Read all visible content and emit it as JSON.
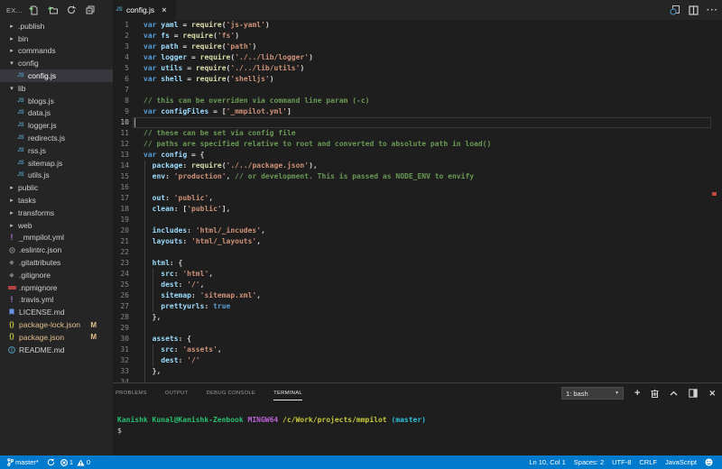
{
  "explorer": {
    "title": "EX...",
    "actions": [
      {
        "name": "new-file"
      },
      {
        "name": "new-folder"
      },
      {
        "name": "refresh"
      },
      {
        "name": "collapse-all"
      }
    ],
    "items": [
      {
        "label": ".publish",
        "kind": "folder",
        "depth": 0,
        "expanded": false
      },
      {
        "label": "bin",
        "kind": "folder",
        "depth": 0,
        "expanded": false
      },
      {
        "label": "commands",
        "kind": "folder",
        "depth": 0,
        "expanded": false
      },
      {
        "label": "config",
        "kind": "folder",
        "depth": 0,
        "expanded": true
      },
      {
        "label": "config.js",
        "kind": "file",
        "depth": 1,
        "icon": "js",
        "selected": true
      },
      {
        "label": "lib",
        "kind": "folder",
        "depth": 0,
        "expanded": true
      },
      {
        "label": "blogs.js",
        "kind": "file",
        "depth": 1,
        "icon": "js"
      },
      {
        "label": "data.js",
        "kind": "file",
        "depth": 1,
        "icon": "js"
      },
      {
        "label": "logger.js",
        "kind": "file",
        "depth": 1,
        "icon": "js"
      },
      {
        "label": "redirects.js",
        "kind": "file",
        "depth": 1,
        "icon": "js"
      },
      {
        "label": "rss.js",
        "kind": "file",
        "depth": 1,
        "icon": "js"
      },
      {
        "label": "sitemap.js",
        "kind": "file",
        "depth": 1,
        "icon": "js"
      },
      {
        "label": "utils.js",
        "kind": "file",
        "depth": 1,
        "icon": "js"
      },
      {
        "label": "public",
        "kind": "folder",
        "depth": 0,
        "expanded": false
      },
      {
        "label": "tasks",
        "kind": "folder",
        "depth": 0,
        "expanded": false
      },
      {
        "label": "transforms",
        "kind": "folder",
        "depth": 0,
        "expanded": false
      },
      {
        "label": "web",
        "kind": "folder",
        "depth": 0,
        "expanded": false
      },
      {
        "label": "_mmpilot.yml",
        "kind": "file",
        "depth": 0,
        "icon": "yml"
      },
      {
        "label": ".eslintrc.json",
        "kind": "file",
        "depth": 0,
        "icon": "eslint"
      },
      {
        "label": ".gitattributes",
        "kind": "file",
        "depth": 0,
        "icon": "git"
      },
      {
        "label": ".gitignore",
        "kind": "file",
        "depth": 0,
        "icon": "git"
      },
      {
        "label": ".npmignore",
        "kind": "file",
        "depth": 0,
        "icon": "npm"
      },
      {
        "label": ".travis.yml",
        "kind": "file",
        "depth": 0,
        "icon": "yml"
      },
      {
        "label": "LICENSE.md",
        "kind": "file",
        "depth": 0,
        "icon": "license"
      },
      {
        "label": "package-lock.json",
        "kind": "file",
        "depth": 0,
        "icon": "json",
        "modified": true,
        "badge": "M"
      },
      {
        "label": "package.json",
        "kind": "file",
        "depth": 0,
        "icon": "json",
        "modified": true,
        "badge": "M"
      },
      {
        "label": "README.md",
        "kind": "file",
        "depth": 0,
        "icon": "info"
      }
    ]
  },
  "editor": {
    "tab": {
      "icon": "js",
      "label": "config.js",
      "close": "×"
    },
    "actions": [
      {
        "name": "open-changes"
      },
      {
        "name": "split-editor"
      },
      {
        "name": "more-actions"
      }
    ],
    "cursor_line": 10,
    "lines": [
      {
        "n": 1,
        "tokens": [
          [
            "kw",
            "var"
          ],
          [
            "pl",
            " "
          ],
          [
            "id",
            "yaml"
          ],
          [
            "pl",
            " = "
          ],
          [
            "fn",
            "require"
          ],
          [
            "pl",
            "("
          ],
          [
            "str",
            "'js-yaml'"
          ],
          [
            "pl",
            ")"
          ]
        ]
      },
      {
        "n": 2,
        "tokens": [
          [
            "kw",
            "var"
          ],
          [
            "pl",
            " "
          ],
          [
            "id",
            "fs"
          ],
          [
            "pl",
            " = "
          ],
          [
            "fn",
            "require"
          ],
          [
            "pl",
            "("
          ],
          [
            "str",
            "'fs'"
          ],
          [
            "pl",
            ")"
          ]
        ]
      },
      {
        "n": 3,
        "tokens": [
          [
            "kw",
            "var"
          ],
          [
            "pl",
            " "
          ],
          [
            "id",
            "path"
          ],
          [
            "pl",
            " = "
          ],
          [
            "fn",
            "require"
          ],
          [
            "pl",
            "("
          ],
          [
            "str",
            "'path'"
          ],
          [
            "pl",
            ")"
          ]
        ]
      },
      {
        "n": 4,
        "tokens": [
          [
            "kw",
            "var"
          ],
          [
            "pl",
            " "
          ],
          [
            "id",
            "logger"
          ],
          [
            "pl",
            " = "
          ],
          [
            "fn",
            "require"
          ],
          [
            "pl",
            "("
          ],
          [
            "str",
            "'./../lib/logger'"
          ],
          [
            "pl",
            ")"
          ]
        ]
      },
      {
        "n": 5,
        "tokens": [
          [
            "kw",
            "var"
          ],
          [
            "pl",
            " "
          ],
          [
            "id",
            "utils"
          ],
          [
            "pl",
            " = "
          ],
          [
            "fn",
            "require"
          ],
          [
            "pl",
            "("
          ],
          [
            "str",
            "'./../lib/utils'"
          ],
          [
            "pl",
            ")"
          ]
        ]
      },
      {
        "n": 6,
        "tokens": [
          [
            "kw",
            "var"
          ],
          [
            "pl",
            " "
          ],
          [
            "id",
            "shell"
          ],
          [
            "pl",
            " = "
          ],
          [
            "fn",
            "require"
          ],
          [
            "pl",
            "("
          ],
          [
            "str",
            "'shelljs'"
          ],
          [
            "pl",
            ")"
          ]
        ]
      },
      {
        "n": 7,
        "tokens": []
      },
      {
        "n": 8,
        "tokens": [
          [
            "cm",
            "// this can be overriden via command line param (-c)"
          ]
        ]
      },
      {
        "n": 9,
        "tokens": [
          [
            "kw",
            "var"
          ],
          [
            "pl",
            " "
          ],
          [
            "id",
            "configFiles"
          ],
          [
            "pl",
            " = ["
          ],
          [
            "str",
            "'_mmpilot.yml'"
          ],
          [
            "pl",
            "]"
          ]
        ]
      },
      {
        "n": 10,
        "tokens": []
      },
      {
        "n": 11,
        "tokens": [
          [
            "cm",
            "// these can be set via config file"
          ]
        ]
      },
      {
        "n": 12,
        "tokens": [
          [
            "cm",
            "// paths are specified relative to root and converted to absolute path in load()"
          ]
        ]
      },
      {
        "n": 13,
        "tokens": [
          [
            "kw",
            "var"
          ],
          [
            "pl",
            " "
          ],
          [
            "id",
            "config"
          ],
          [
            "pl",
            " = {"
          ]
        ]
      },
      {
        "n": 14,
        "tokens": [
          [
            "pl",
            "  "
          ],
          [
            "id",
            "package"
          ],
          [
            "pl",
            ": "
          ],
          [
            "fn",
            "require"
          ],
          [
            "pl",
            "("
          ],
          [
            "str",
            "'./../package.json'"
          ],
          [
            "pl",
            "),"
          ]
        ]
      },
      {
        "n": 15,
        "tokens": [
          [
            "pl",
            "  "
          ],
          [
            "id",
            "env"
          ],
          [
            "pl",
            ": "
          ],
          [
            "str",
            "'production'"
          ],
          [
            "pl",
            ", "
          ],
          [
            "cm",
            "// or development. This is passed as NODE_ENV to envify"
          ]
        ]
      },
      {
        "n": 16,
        "tokens": []
      },
      {
        "n": 17,
        "tokens": [
          [
            "pl",
            "  "
          ],
          [
            "id",
            "out"
          ],
          [
            "pl",
            ": "
          ],
          [
            "str",
            "'public'"
          ],
          [
            "pl",
            ","
          ]
        ]
      },
      {
        "n": 18,
        "tokens": [
          [
            "pl",
            "  "
          ],
          [
            "id",
            "clean"
          ],
          [
            "pl",
            ": ["
          ],
          [
            "str",
            "'public'"
          ],
          [
            "pl",
            "],"
          ]
        ]
      },
      {
        "n": 19,
        "tokens": []
      },
      {
        "n": 20,
        "tokens": [
          [
            "pl",
            "  "
          ],
          [
            "id",
            "includes"
          ],
          [
            "pl",
            ": "
          ],
          [
            "str",
            "'html/_incudes'"
          ],
          [
            "pl",
            ","
          ]
        ]
      },
      {
        "n": 21,
        "tokens": [
          [
            "pl",
            "  "
          ],
          [
            "id",
            "layouts"
          ],
          [
            "pl",
            ": "
          ],
          [
            "str",
            "'html/_layouts'"
          ],
          [
            "pl",
            ","
          ]
        ]
      },
      {
        "n": 22,
        "tokens": []
      },
      {
        "n": 23,
        "tokens": [
          [
            "pl",
            "  "
          ],
          [
            "id",
            "html"
          ],
          [
            "pl",
            ": {"
          ]
        ]
      },
      {
        "n": 24,
        "tokens": [
          [
            "pl",
            "    "
          ],
          [
            "id",
            "src"
          ],
          [
            "pl",
            ": "
          ],
          [
            "str",
            "'html'"
          ],
          [
            "pl",
            ","
          ]
        ]
      },
      {
        "n": 25,
        "tokens": [
          [
            "pl",
            "    "
          ],
          [
            "id",
            "dest"
          ],
          [
            "pl",
            ": "
          ],
          [
            "str",
            "'/'"
          ],
          [
            "pl",
            ","
          ]
        ]
      },
      {
        "n": 26,
        "tokens": [
          [
            "pl",
            "    "
          ],
          [
            "id",
            "sitemap"
          ],
          [
            "pl",
            ": "
          ],
          [
            "str",
            "'sitemap.xml'"
          ],
          [
            "pl",
            ","
          ]
        ]
      },
      {
        "n": 27,
        "tokens": [
          [
            "pl",
            "    "
          ],
          [
            "id",
            "prettyurls"
          ],
          [
            "pl",
            ": "
          ],
          [
            "kw",
            "true"
          ]
        ]
      },
      {
        "n": 28,
        "tokens": [
          [
            "pl",
            "  },"
          ]
        ]
      },
      {
        "n": 29,
        "tokens": []
      },
      {
        "n": 30,
        "tokens": [
          [
            "pl",
            "  "
          ],
          [
            "id",
            "assets"
          ],
          [
            "pl",
            ": {"
          ]
        ]
      },
      {
        "n": 31,
        "tokens": [
          [
            "pl",
            "    "
          ],
          [
            "id",
            "src"
          ],
          [
            "pl",
            ": "
          ],
          [
            "str",
            "'assets'"
          ],
          [
            "pl",
            ","
          ]
        ]
      },
      {
        "n": 32,
        "tokens": [
          [
            "pl",
            "    "
          ],
          [
            "id",
            "dest"
          ],
          [
            "pl",
            ": "
          ],
          [
            "str",
            "'/'"
          ]
        ]
      },
      {
        "n": 33,
        "tokens": [
          [
            "pl",
            "  },"
          ]
        ]
      },
      {
        "n": 34,
        "tokens": []
      }
    ]
  },
  "panel": {
    "tabs": [
      {
        "label": "PROBLEMS",
        "active": false
      },
      {
        "label": "OUTPUT",
        "active": false
      },
      {
        "label": "DEBUG CONSOLE",
        "active": false
      },
      {
        "label": "TERMINAL",
        "active": true
      }
    ],
    "shell_select": "1: bash",
    "controls": [
      {
        "name": "new-terminal"
      },
      {
        "name": "kill-terminal"
      },
      {
        "name": "maximize-panel"
      },
      {
        "name": "split-terminal"
      },
      {
        "name": "close-panel"
      }
    ],
    "terminal_lines": [
      {
        "tokens": [
          [
            "g",
            "Kanishk Kunal@Kanishk-Zenbook "
          ],
          [
            "m",
            "MINGW64 "
          ],
          [
            "y",
            "/c/Work/projects/mmpilot "
          ],
          [
            "c",
            "(master)"
          ]
        ]
      },
      {
        "tokens": [
          [
            "p",
            "$"
          ]
        ]
      }
    ]
  },
  "statusbar": {
    "branch": "master*",
    "errors": "1",
    "warnings": "0",
    "right_items": [
      "Ln 10, Col 1",
      "Spaces: 2",
      "UTF-8",
      "CRLF",
      "JavaScript"
    ]
  },
  "colors": {
    "statusbar": "#007acc",
    "editor_bg": "#1e1e1e",
    "sidebar_bg": "#252526",
    "selection_bg": "#37373d",
    "modified": "#e2c08d"
  }
}
